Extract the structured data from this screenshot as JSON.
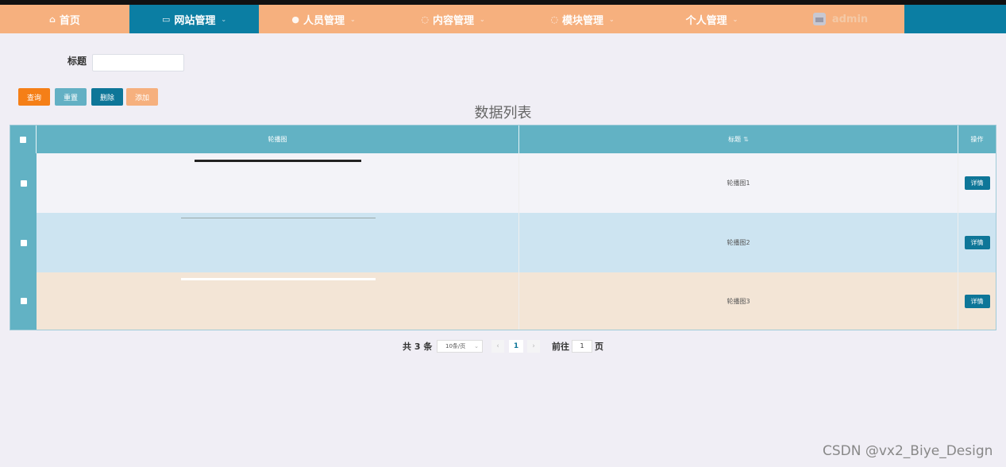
{
  "nav": {
    "items": [
      {
        "label": "首页",
        "icon": "home-icon",
        "glyph": "⌂"
      },
      {
        "label": "网站管理",
        "icon": "monitor-icon",
        "glyph": "▭"
      },
      {
        "label": "人员管理",
        "icon": "user-icon",
        "glyph": "●"
      },
      {
        "label": "内容管理",
        "icon": "chat-icon",
        "glyph": "◌"
      },
      {
        "label": "模块管理",
        "icon": "module-icon",
        "glyph": "◌"
      },
      {
        "label": "个人管理",
        "icon": "",
        "glyph": ""
      }
    ],
    "chevron": "⌄",
    "admin": "admin"
  },
  "search": {
    "label": "标题",
    "value": "",
    "placeholder": ""
  },
  "buttons": {
    "query": "查询",
    "reset": "重置",
    "delete": "删除",
    "add": "添加"
  },
  "list_title": "数据列表",
  "table": {
    "headers": {
      "image": "轮播图",
      "title": "标题",
      "sort_glyph": "⇅",
      "action": "操作"
    },
    "rows": [
      {
        "title": "轮播图1",
        "action": "详情",
        "bg": "#f3f3f8"
      },
      {
        "title": "轮播图2",
        "action": "详情",
        "bg": "#cde4f1"
      },
      {
        "title": "轮播图3",
        "action": "详情",
        "bg": "#f3e5d6"
      }
    ]
  },
  "pagination": {
    "total": "共 3 条",
    "page_size": "10条/页",
    "prev": "‹",
    "next": "›",
    "current": "1",
    "goto_label": "前往",
    "goto_value": "1",
    "page_suffix": "页"
  },
  "watermark": "CSDN @vx2_Biye_Design",
  "colors": {
    "nav_bg": "#f6b07e",
    "nav_active": "#0b7ea3",
    "table_header": "#62b2c4",
    "query_btn": "#f57f17",
    "reset_btn": "#63b0c4",
    "delete_btn": "#0e7698",
    "add_btn": "#f6b07e"
  }
}
